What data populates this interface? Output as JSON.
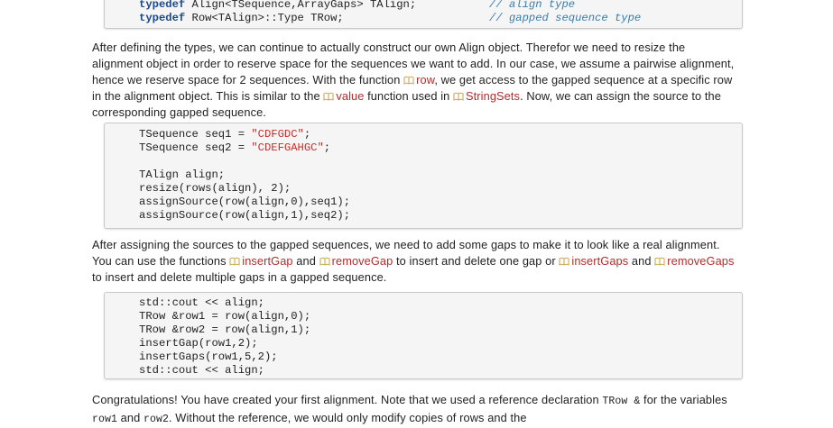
{
  "code_top": {
    "line1_kw": "typedef",
    "line1_code": " Align<TSequence,ArrayGaps> TAlign;",
    "line1_comment": "// align type",
    "line2_kw": "typedef",
    "line2_code": " Row<TAlign>::Type TRow;",
    "line2_comment": "// gapped sequence type"
  },
  "para1": {
    "t1": "After defining the types, we can continue to actually construct our own Align object. Therefor we need to resize the alignment object in order to reserve space for the sequences we want to add. In our case, we assume a pairwise alignment, hence we reserve space for 2 sequences. With the function ",
    "ref_row": "row",
    "t2": ", we get access to the gapped sequence at a specific row in the alignment object. This is similar to the ",
    "ref_value": "value",
    "t3": " function used in ",
    "ref_stringsets": "StringSets",
    "t4": ". Now, we can assign the source to the corresponding gapped sequence."
  },
  "code_mid": {
    "l1a": "TSequence seq1 = ",
    "l1s": "\"CDFGDC\"",
    "l1e": ";",
    "l2a": "TSequence seq2 = ",
    "l2s": "\"CDEFGAHGC\"",
    "l2e": ";",
    "l3": "TAlign align;",
    "l4": "resize(rows(align), 2);",
    "l5": "assignSource(row(align,0),seq1);",
    "l6": "assignSource(row(align,1),seq2);"
  },
  "para2": {
    "t1": "After assigning the sources to the gapped sequences, we need to add some gaps to make it to look like a real alignment. You can use the functions ",
    "ref_insertgap": "insertGap",
    "t2": " and ",
    "ref_removegap": "removeGap",
    "t3": " to insert and delete one gap or ",
    "ref_insertgaps": "insertGaps",
    "t4": " and ",
    "ref_removegaps": "removeGaps",
    "t5": " to insert and delete multiple gaps in a gapped sequence."
  },
  "code_bot": {
    "l1": "std::cout << align;",
    "l2": "TRow &row1 = row(align,0);",
    "l3": "TRow &row2 = row(align,1);",
    "l4": "insertGap(row1,2);",
    "l5": "insertGaps(row1,5,2);",
    "l6": "std::cout << align;"
  },
  "para3": {
    "t1": "Congratulations! You have created your first alignment. Note that we used a reference declaration ",
    "m1": "TRow &",
    "t2": " for the variables ",
    "m2": "row1",
    "t3": " and ",
    "m3": "row2",
    "t4": ". Without the reference, we would only modify copies of rows and the"
  },
  "colors": {
    "link": "#b32d2d",
    "keyword": "#204a87",
    "comment": "#3a7dad",
    "string": "#c4302b",
    "code_bg": "#f5f5f5"
  },
  "icons": {
    "reference": "book-icon"
  }
}
